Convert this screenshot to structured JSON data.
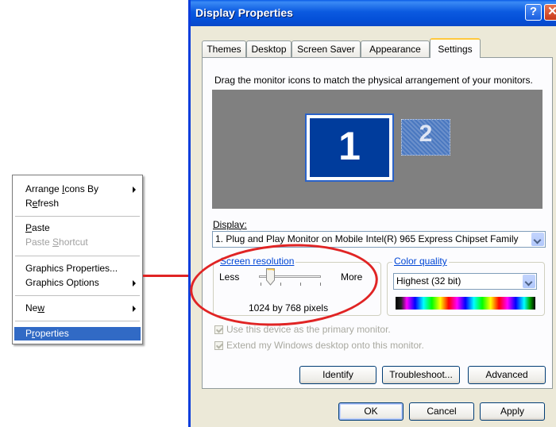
{
  "context_menu": {
    "items": [
      {
        "label": "Arrange Icons By",
        "accel": "I",
        "submenu": true,
        "disabled": false,
        "highlighted": false
      },
      {
        "label": "Refresh",
        "accel": "e",
        "submenu": false,
        "disabled": false,
        "highlighted": false
      },
      {
        "label": "Paste",
        "accel": "P",
        "submenu": false,
        "disabled": false,
        "highlighted": false
      },
      {
        "label": "Paste Shortcut",
        "accel": "S",
        "submenu": false,
        "disabled": true,
        "highlighted": false
      },
      {
        "label": "Graphics Properties...",
        "accel": "",
        "submenu": false,
        "disabled": false,
        "highlighted": false
      },
      {
        "label": "Graphics Options",
        "accel": "",
        "submenu": true,
        "disabled": false,
        "highlighted": false
      },
      {
        "label": "New",
        "accel": "w",
        "submenu": true,
        "disabled": false,
        "highlighted": false
      },
      {
        "label": "Properties",
        "accel": "r",
        "submenu": false,
        "disabled": false,
        "highlighted": true
      }
    ]
  },
  "window": {
    "title": "Display Properties",
    "help_glyph": "?",
    "close_glyph": "✕",
    "tabs": [
      "Themes",
      "Desktop",
      "Screen Saver",
      "Appearance",
      "Settings"
    ],
    "active_tab": "Settings",
    "instruction": "Drag the monitor icons to match the physical arrangement of your monitors.",
    "monitors": [
      "1",
      "2"
    ],
    "display_label": "Display:",
    "display_value": "1. Plug and Play Monitor on Mobile Intel(R) 965 Express Chipset Family",
    "resolution": {
      "group_label": "Screen resolution",
      "less": "Less",
      "more": "More",
      "value": "1024 by 768 pixels"
    },
    "color_quality": {
      "group_label": "Color quality",
      "value": "Highest (32 bit)"
    },
    "checkboxes": [
      {
        "label": "Use this device as the primary monitor.",
        "checked": true,
        "disabled": true
      },
      {
        "label": "Extend my Windows desktop onto this monitor.",
        "checked": true,
        "disabled": true
      }
    ],
    "buttons": {
      "identify": "Identify",
      "troubleshoot": "Troubleshoot...",
      "advanced": "Advanced",
      "ok": "OK",
      "cancel": "Cancel",
      "apply": "Apply"
    }
  },
  "colors": {
    "highlight_ring": "#e02424",
    "title_bar": "#0450d8",
    "menu_highlight": "#316ac5"
  }
}
